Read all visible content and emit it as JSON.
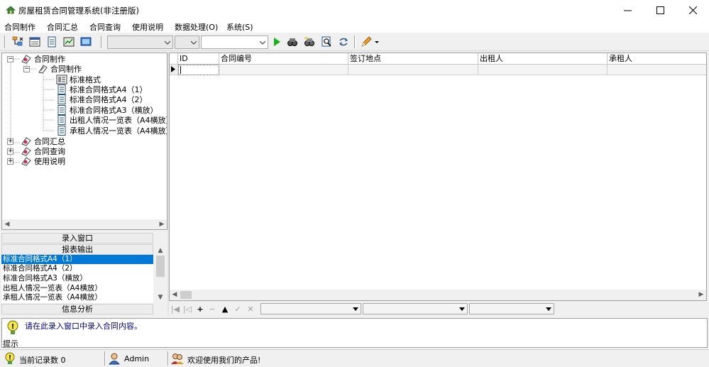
{
  "window": {
    "title": "房屋租赁合同管理系统(非注册版)"
  },
  "menu": [
    {
      "label": "合同制作"
    },
    {
      "label": "合同汇总"
    },
    {
      "label": "合同查询"
    },
    {
      "label": "使用说明"
    },
    {
      "label": "数据处理(O)"
    },
    {
      "label": "系统(S)"
    }
  ],
  "tree": {
    "nodes": [
      {
        "label": "合同制作",
        "level": 0,
        "expanded": true
      },
      {
        "label": "合同制作",
        "level": 1,
        "expanded": true
      },
      {
        "label": "标准格式",
        "level": 2
      },
      {
        "label": "标准合同格式A4（1）",
        "level": 2
      },
      {
        "label": "标准合同格式A4（2）",
        "level": 2
      },
      {
        "label": "标准合同格式A3（横放）",
        "level": 2
      },
      {
        "label": "出租人情况一览表（A4横放）",
        "level": 2
      },
      {
        "label": "承租人情况一览表（A4横放）",
        "level": 2
      },
      {
        "label": "合同汇总",
        "level": 0,
        "expanded": false
      },
      {
        "label": "合同查询",
        "level": 0,
        "expanded": false
      },
      {
        "label": "使用说明",
        "level": 0,
        "expanded": false
      }
    ]
  },
  "left_sections": {
    "entry_window": "录入窗口",
    "report_output": "报表输出",
    "info_analysis": "信息分析"
  },
  "report_list": {
    "items": [
      "标准合同格式A4（1）",
      "标准合同格式A4（2）",
      "标准合同格式A3（横放）",
      "出租人情况一览表（A4横放）",
      "承租人情况一览表（A4横放）"
    ],
    "selected_index": 0
  },
  "grid": {
    "columns": [
      "ID",
      "合同编号",
      "签订地点",
      "出租人",
      "承租人"
    ]
  },
  "hint": {
    "text": "请在此录入窗口中录入合同内容。",
    "label": "提示"
  },
  "status": {
    "record_count_label": "当前记录数 0",
    "user": "Admin",
    "welcome": "欢迎使用我们的产品!"
  },
  "colors": {
    "selection": "#0078d7",
    "hint_text": "#000080"
  }
}
